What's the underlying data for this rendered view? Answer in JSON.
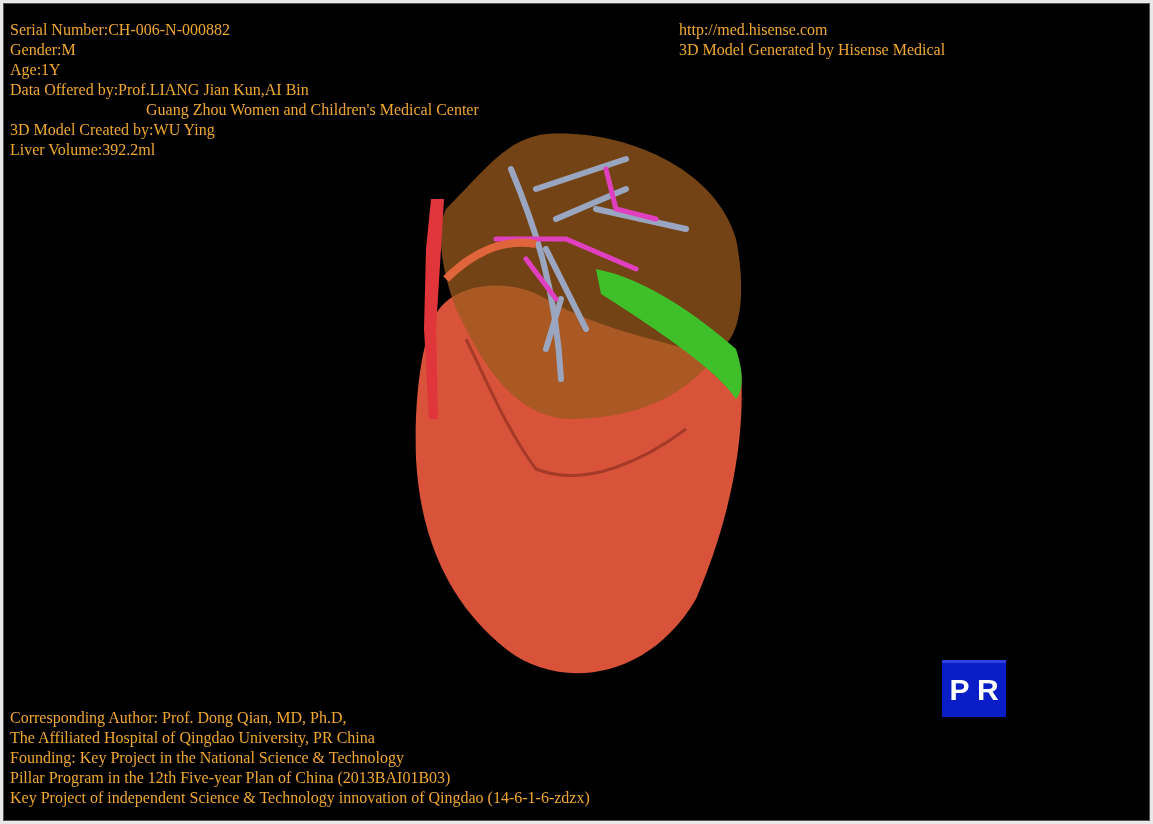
{
  "info_top_left": [
    {
      "text": "Serial Number:CH-006-N-000882",
      "kind": "line"
    },
    {
      "text": "Gender:M",
      "kind": "line"
    },
    {
      "text": "Age:1Y",
      "kind": "line"
    },
    {
      "text": "Data Offered by:Prof.LIANG Jian Kun,AI Bin",
      "kind": "line"
    },
    {
      "text": "Guang Zhou Women and Children's Medical Center",
      "kind": "continuation"
    },
    {
      "text": "3D Model Created by:WU Ying",
      "kind": "line"
    },
    {
      "text": "Liver Volume:392.2ml",
      "kind": "line"
    }
  ],
  "info_top_right": [
    {
      "text": "http://med.hisense.com"
    },
    {
      "text": "3D Model Generated by Hisense Medical"
    }
  ],
  "credits": [
    {
      "text": "Corresponding Author: Prof. Dong Qian, MD, Ph.D,"
    },
    {
      "text": "The Affiliated Hospital of Qingdao University, PR China"
    },
    {
      "text": "Founding: Key Project in the National Science & Technology"
    },
    {
      "text": "Pillar Program in the 12th Five-year Plan of China (2013BAI01B03)"
    },
    {
      "text": "Key Project of independent Science & Technology innovation of Qingdao (14-6-1-6-zdzx)"
    }
  ],
  "orientation_cube": {
    "labels": [
      "P",
      "R"
    ]
  }
}
